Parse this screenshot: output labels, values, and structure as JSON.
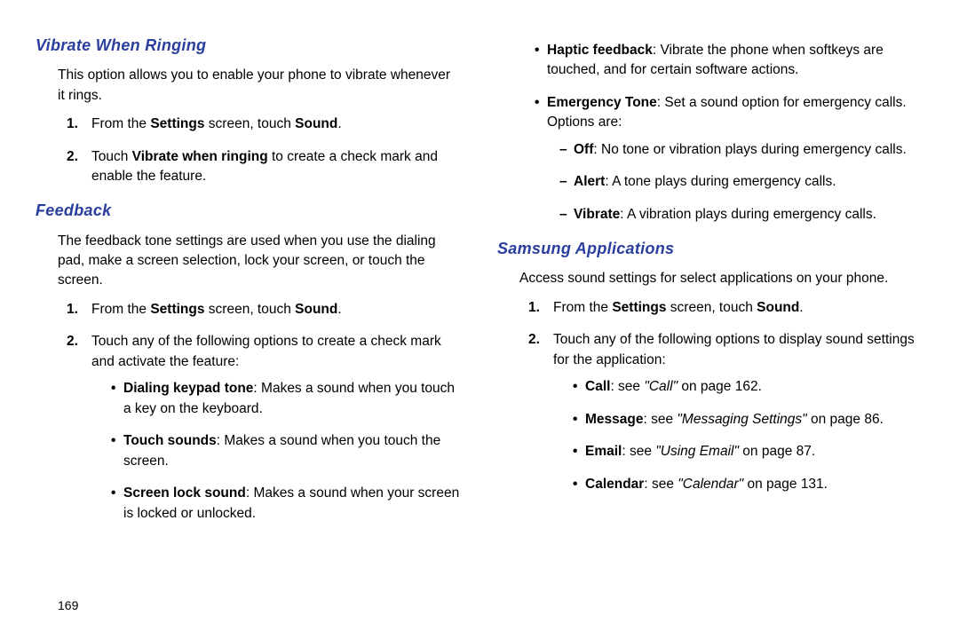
{
  "pageNumber": "169",
  "left": {
    "sec1": {
      "title": "Vibrate When Ringing",
      "intro": "This option allows you to enable your phone to vibrate whenever it rings.",
      "step1_a": "From the ",
      "step1_b": "Settings",
      "step1_c": " screen, touch ",
      "step1_d": "Sound",
      "step1_e": ".",
      "step2_a": "Touch ",
      "step2_b": "Vibrate when ringing",
      "step2_c": " to create a check mark and enable the feature."
    },
    "sec2": {
      "title": "Feedback",
      "intro": "The feedback tone settings are used when you use the dialing pad, make a screen selection, lock your screen, or touch the screen.",
      "step1_a": "From the ",
      "step1_b": "Settings",
      "step1_c": " screen, touch ",
      "step1_d": "Sound",
      "step1_e": ".",
      "step2": "Touch any of the following options to create a check mark and activate the feature:",
      "b1_a": "Dialing keypad tone",
      "b1_b": ": Makes a sound when you touch a key on the keyboard.",
      "b2_a": "Touch sounds",
      "b2_b": ": Makes a sound when you touch the screen.",
      "b3_a": "Screen lock sound",
      "b3_b": ": Makes a sound when your screen is locked or unlocked."
    }
  },
  "right": {
    "cont": {
      "b4_a": "Haptic feedback",
      "b4_b": ": Vibrate the phone when softkeys are touched, and for certain software actions.",
      "b5_a": "Emergency Tone",
      "b5_b": ": Set a sound option for emergency calls. Options are:",
      "d1_a": "Off",
      "d1_b": ": No tone or vibration plays during emergency calls.",
      "d2_a": "Alert",
      "d2_b": ": A tone plays during emergency calls.",
      "d3_a": "Vibrate",
      "d3_b": ": A vibration plays during emergency calls."
    },
    "sec3": {
      "title": "Samsung Applications",
      "intro": "Access sound settings for select applications on your phone.",
      "step1_a": "From the ",
      "step1_b": "Settings",
      "step1_c": " screen, touch ",
      "step1_d": "Sound",
      "step1_e": ".",
      "step2": "Touch any of the following options to display sound settings for the application:",
      "b1_a": "Call",
      "b1_b": ": see ",
      "b1_c": "\"Call\"",
      "b1_d": " on page 162.",
      "b2_a": "Message",
      "b2_b": ": see ",
      "b2_c": "\"Messaging Settings\"",
      "b2_d": " on page 86.",
      "b3_a": "Email",
      "b3_b": ": see ",
      "b3_c": "\"Using Email\"",
      "b3_d": " on page 87.",
      "b4_a": "Calendar",
      "b4_b": ": see ",
      "b4_c": "\"Calendar\"",
      "b4_d": " on page 131."
    }
  }
}
